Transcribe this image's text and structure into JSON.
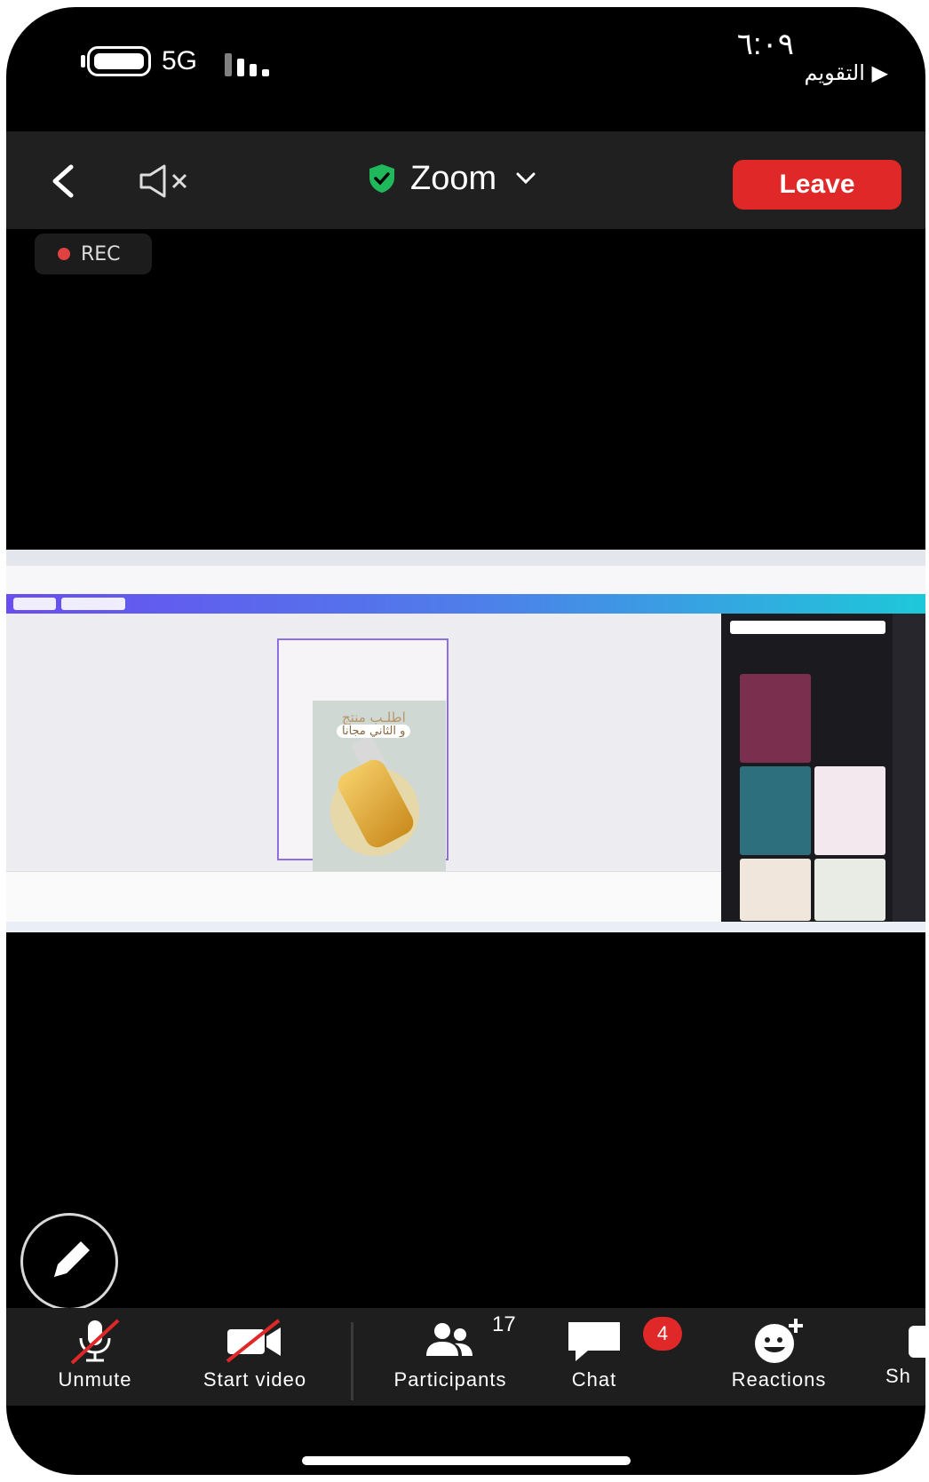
{
  "status_bar": {
    "network": "5G",
    "time": "٦:٠٩",
    "back_to_app": "التقويم"
  },
  "top_bar": {
    "title": "Zoom",
    "leave_label": "Leave"
  },
  "recording": {
    "label": "REC"
  },
  "shared_screen": {
    "poster_line1": "اطلـب منتج",
    "poster_line2": "و الثاني مجانا"
  },
  "toolbar": {
    "items": [
      {
        "label": "Unmute",
        "icon": "muted-mic-icon"
      },
      {
        "label": "Start video",
        "icon": "video-off-icon"
      },
      {
        "label": "Participants",
        "icon": "participants-icon"
      },
      {
        "label": "Chat",
        "icon": "chat-icon"
      },
      {
        "label": "Reactions",
        "icon": "reactions-icon"
      },
      {
        "label": "Sh",
        "icon": "share-icon"
      }
    ],
    "participants_count": "17",
    "chat_badge": "4"
  },
  "colors": {
    "leave": "#e02828",
    "shield": "#1fb85a",
    "badge": "#e02828",
    "background": "#000000"
  }
}
